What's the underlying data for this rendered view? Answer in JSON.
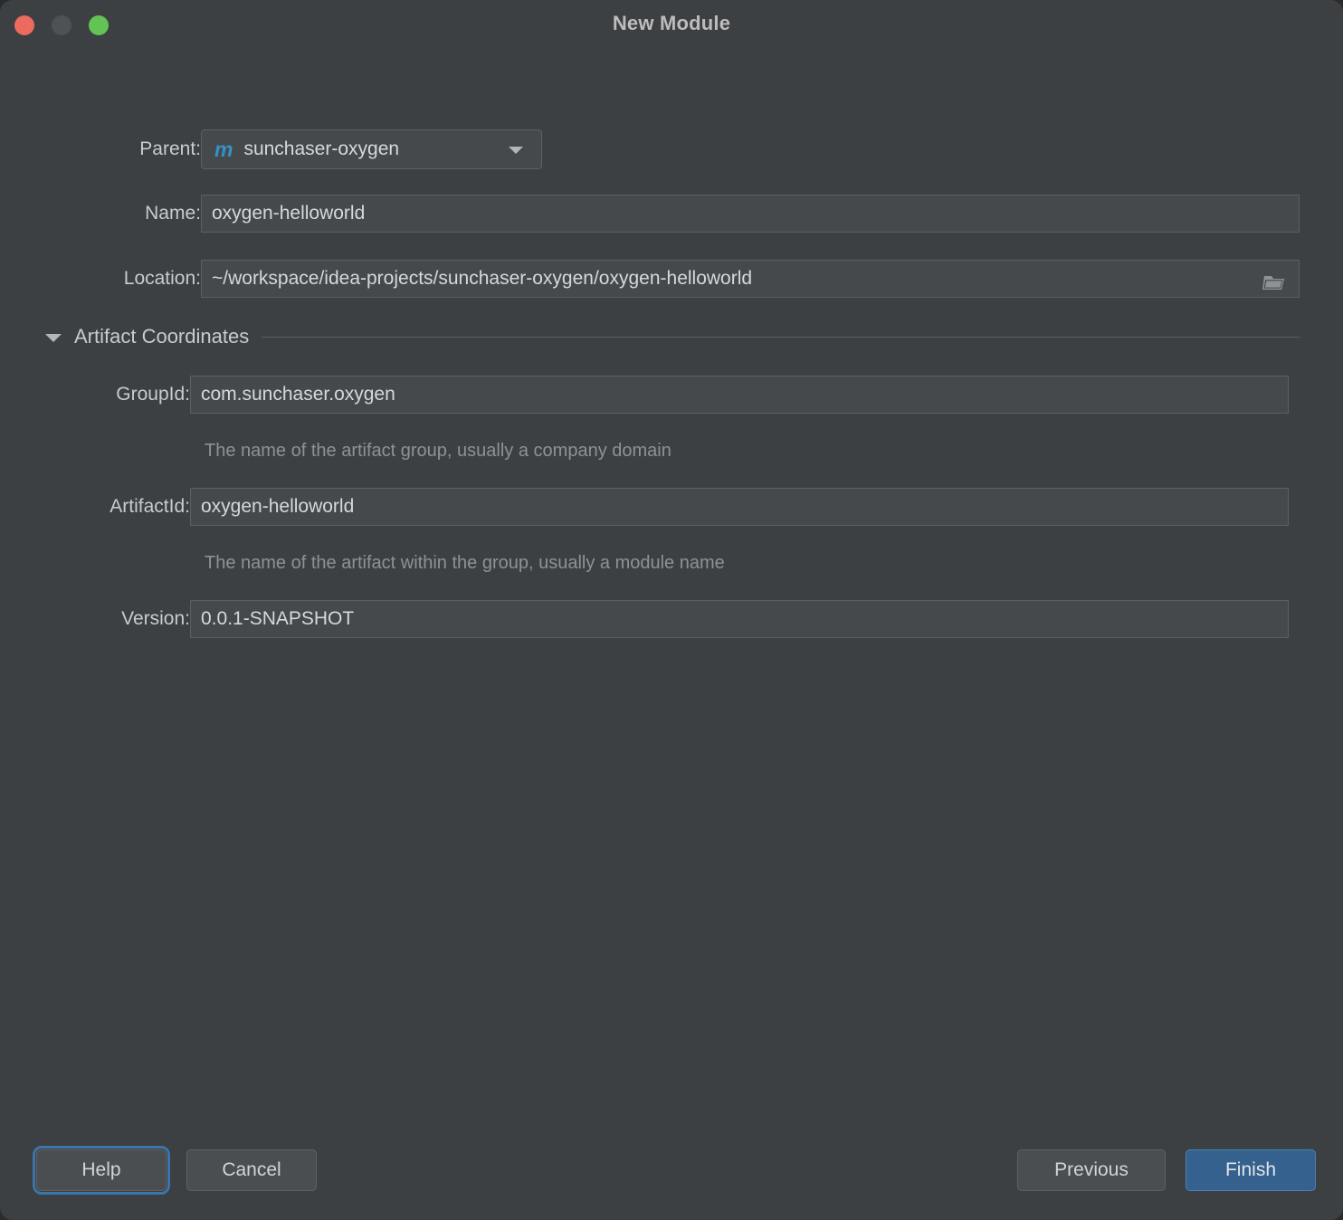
{
  "window": {
    "title": "New Module",
    "traffic_lights": [
      {
        "name": "close",
        "color": "#ec6a5e"
      },
      {
        "name": "minimize",
        "color": "#4e5256"
      },
      {
        "name": "maximize",
        "color": "#61c454"
      }
    ]
  },
  "form": {
    "parent": {
      "label": "Parent:",
      "value": "sunchaser-oxygen",
      "icon": "maven-m-icon",
      "icon_glyph": "m",
      "icon_color": "#3592c4"
    },
    "name": {
      "label": "Name:",
      "value": "oxygen-helloworld",
      "placeholder": ""
    },
    "location": {
      "label": "Location:",
      "value": "~/workspace/idea-projects/sunchaser-oxygen/oxygen-helloworld",
      "placeholder": "",
      "browse_icon": "folder-icon"
    },
    "artifact_coordinates": {
      "section_label": "Artifact Coordinates",
      "expanded": true,
      "group_id": {
        "label": "GroupId:",
        "value": "com.sunchaser.oxygen",
        "hint": "The name of the artifact group, usually a company domain"
      },
      "artifact_id": {
        "label": "ArtifactId:",
        "value": "oxygen-helloworld",
        "hint": "The name of the artifact within the group, usually a module name"
      },
      "version": {
        "label": "Version:",
        "value": "0.0.1-SNAPSHOT",
        "hint": ""
      }
    }
  },
  "footer": {
    "help": "Help",
    "cancel": "Cancel",
    "previous": "Previous",
    "finish": "Finish"
  },
  "colors": {
    "window_background": "#3c4043",
    "field_background": "#45494c",
    "field_border": "#5c6063",
    "accent_blue": "#34618e",
    "focus_ring": "#3c74ab",
    "text_primary": "#d6d8da",
    "text_label": "#c9cbcd",
    "text_hint": "#8e9295"
  }
}
